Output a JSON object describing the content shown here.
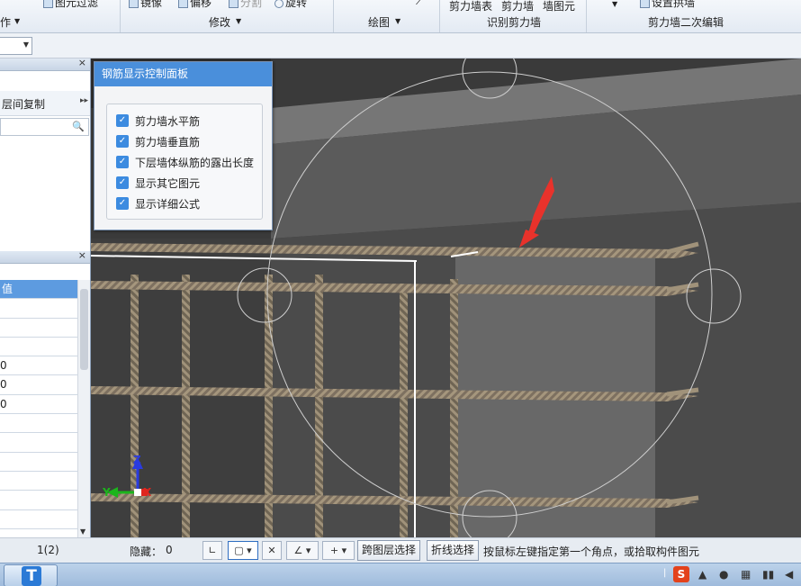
{
  "ribbon": {
    "top_items": {
      "filter_label": "图元过滤",
      "mirror_label": "镜像",
      "offset_label": "偏移",
      "split_label": "分割",
      "rotate_label": "旋转",
      "wall_table_label": "剪力墙表",
      "shear_wall_label": "剪力墙",
      "wall_element_label": "墙图元",
      "set_arch_wall_label": "设置拱墙"
    },
    "groups": {
      "operate": "作",
      "modify": "修改",
      "draw": "绘图",
      "identify_wall": "识别剪力墙",
      "wall_secondary_edit": "剪力墙二次编辑"
    }
  },
  "left_panel": {
    "floor_copy_label": "层间复制",
    "property_header": "值",
    "property_values": [
      "",
      "",
      "",
      "0",
      "0",
      "0",
      "",
      "",
      "",
      "",
      "",
      ""
    ]
  },
  "rebar_panel": {
    "title": "钢筋显示控制面板",
    "options": [
      {
        "label": "剪力墙水平筋",
        "checked": true
      },
      {
        "label": "剪力墙垂直筋",
        "checked": true
      },
      {
        "label": "下层墙体纵筋的露出长度",
        "checked": true
      },
      {
        "label": "显示其它图元",
        "checked": true
      },
      {
        "label": "显示详细公式",
        "checked": true
      }
    ]
  },
  "viewport": {
    "axis_labels": {
      "z": "Z",
      "y": "Y",
      "x": "X"
    },
    "colors": {
      "background": "#3c3c3c",
      "rebar": "#8a7d66",
      "highlight_arrow": "#e8322b",
      "wall_face": "#707070"
    }
  },
  "statusbar": {
    "page_indicator": "1(2)",
    "hidden_label": "隐藏：",
    "hidden_count": "0",
    "cross_layer_select": "跨图层选择",
    "polyline_select": "折线选择",
    "hint": "按鼠标左键指定第一个角点，或拾取构件图元"
  },
  "taskbar": {
    "app_icon_letter": "T",
    "tray_icons": [
      "sogou-icon",
      "qq-icon",
      "network-icon",
      "volume-icon"
    ]
  }
}
